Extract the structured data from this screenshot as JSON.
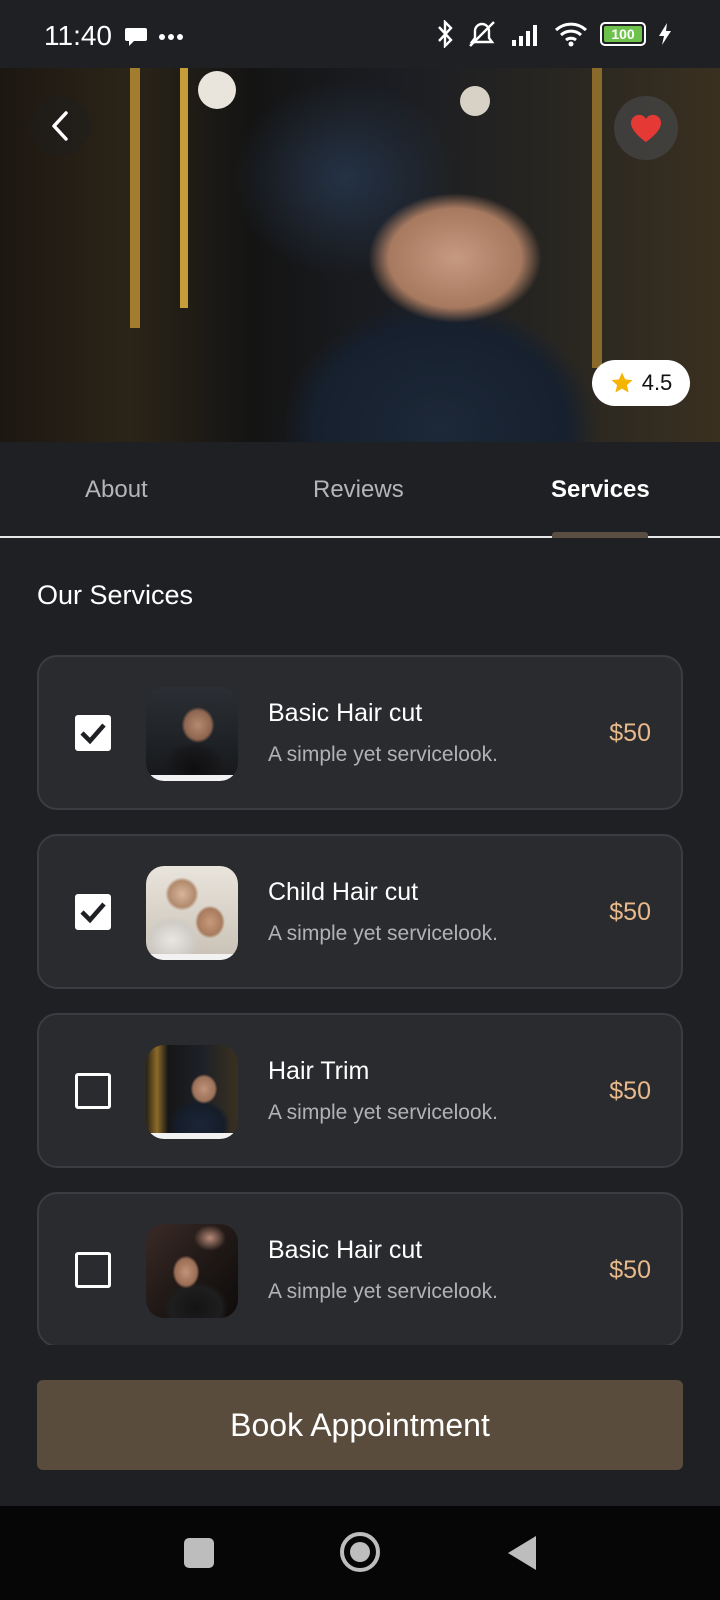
{
  "status_bar": {
    "time": "11:40",
    "left_icons": [
      "chat-bubble-icon",
      "more-dots-icon"
    ],
    "right_icons": [
      "bluetooth-icon",
      "alarm-off-icon",
      "signal-icon",
      "wifi-icon",
      "battery-icon",
      "charging-icon"
    ],
    "battery_level": "100"
  },
  "hero": {
    "back_icon": "chevron-left-icon",
    "favorite_icon": "heart-icon",
    "favorite_color": "#e53935",
    "rating": "4.5",
    "rating_icon": "star-icon",
    "star_color": "#f5b400"
  },
  "tabs": [
    {
      "label": "About",
      "active": false
    },
    {
      "label": "Reviews",
      "active": false
    },
    {
      "label": "Services",
      "active": true
    }
  ],
  "services": {
    "title": "Our Services",
    "items": [
      {
        "name": "Basic Hair cut",
        "description": "A simple yet servicelook.",
        "price": "$50",
        "checked": true
      },
      {
        "name": "Child Hair cut",
        "description": "A simple yet servicelook.",
        "price": "$50",
        "checked": true
      },
      {
        "name": "Hair Trim",
        "description": "A simple yet servicelook.",
        "price": "$50",
        "checked": false
      },
      {
        "name": "Basic Hair cut",
        "description": "A simple yet servicelook.",
        "price": "$50",
        "checked": false
      }
    ]
  },
  "book_button": {
    "label": "Book Appointment"
  },
  "colors": {
    "background": "#1f2024",
    "card": "#2a2b2f",
    "price": "#e8b98b",
    "button": "#5a4c3c"
  },
  "nav_bar": {
    "icons": [
      "recents-square-icon",
      "home-circle-icon",
      "back-triangle-icon"
    ]
  }
}
